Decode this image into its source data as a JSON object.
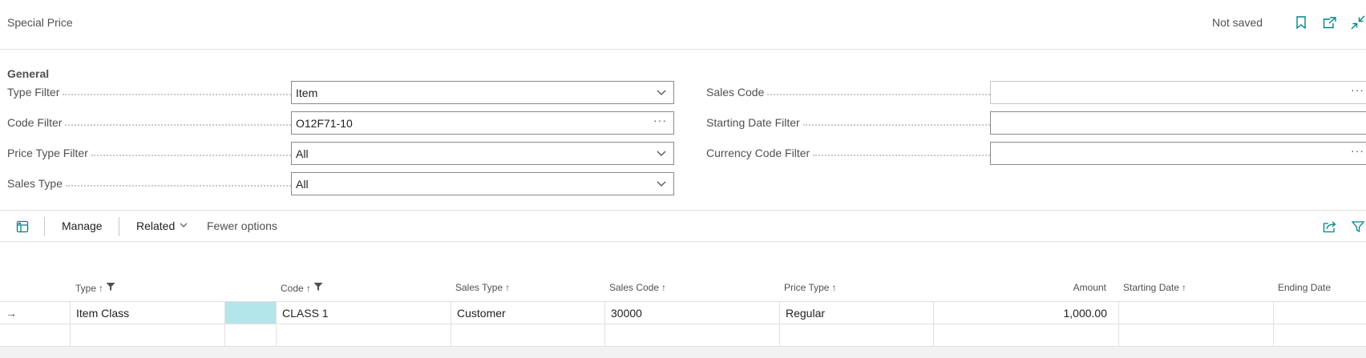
{
  "header": {
    "title": "Special Price",
    "status": "Not saved",
    "icons": [
      "bookmark-icon",
      "open-new-window-icon",
      "collapse-icon"
    ]
  },
  "general": {
    "title": "General",
    "left_fields": [
      {
        "label": "Type Filter",
        "value": "Item",
        "control": "dropdown"
      },
      {
        "label": "Code Filter",
        "value": "O12F71-10",
        "control": "lookup"
      },
      {
        "label": "Price Type Filter",
        "value": "All",
        "control": "dropdown"
      },
      {
        "label": "Sales Type",
        "value": "All",
        "control": "dropdown"
      }
    ],
    "right_fields": [
      {
        "label": "Sales Code",
        "value": "",
        "control": "lookup-readonly"
      },
      {
        "label": "Starting Date Filter",
        "value": "",
        "control": "text"
      },
      {
        "label": "Currency Code Filter",
        "value": "",
        "control": "lookup"
      }
    ],
    "lookup_glyph": "···"
  },
  "toolbar": {
    "manage": "Manage",
    "related": "Related",
    "fewer_options": "Fewer options"
  },
  "table": {
    "columns": [
      {
        "label": "Type",
        "sort": "↑",
        "filter": true
      },
      {
        "label": "Code",
        "sort": "↑",
        "filter": true
      },
      {
        "label": "Sales Type",
        "sort": "↑",
        "filter": false
      },
      {
        "label": "Sales Code",
        "sort": "↑",
        "filter": false
      },
      {
        "label": "Price Type",
        "sort": "↑",
        "filter": false
      },
      {
        "label": "Amount",
        "sort": "",
        "filter": false
      },
      {
        "label": "Starting Date",
        "sort": "↑",
        "filter": false
      },
      {
        "label": "Ending Date",
        "sort": "",
        "filter": false
      }
    ],
    "rows": [
      {
        "indicator": "→",
        "type": "Item Class",
        "code": "CLASS 1",
        "sales_type": "Customer",
        "sales_code": "30000",
        "price_type": "Regular",
        "amount": "1,000.00",
        "starting_date": "",
        "ending_date": ""
      }
    ]
  },
  "colors": {
    "accent": "#008489",
    "selected_cell": "#b3e6ea"
  }
}
